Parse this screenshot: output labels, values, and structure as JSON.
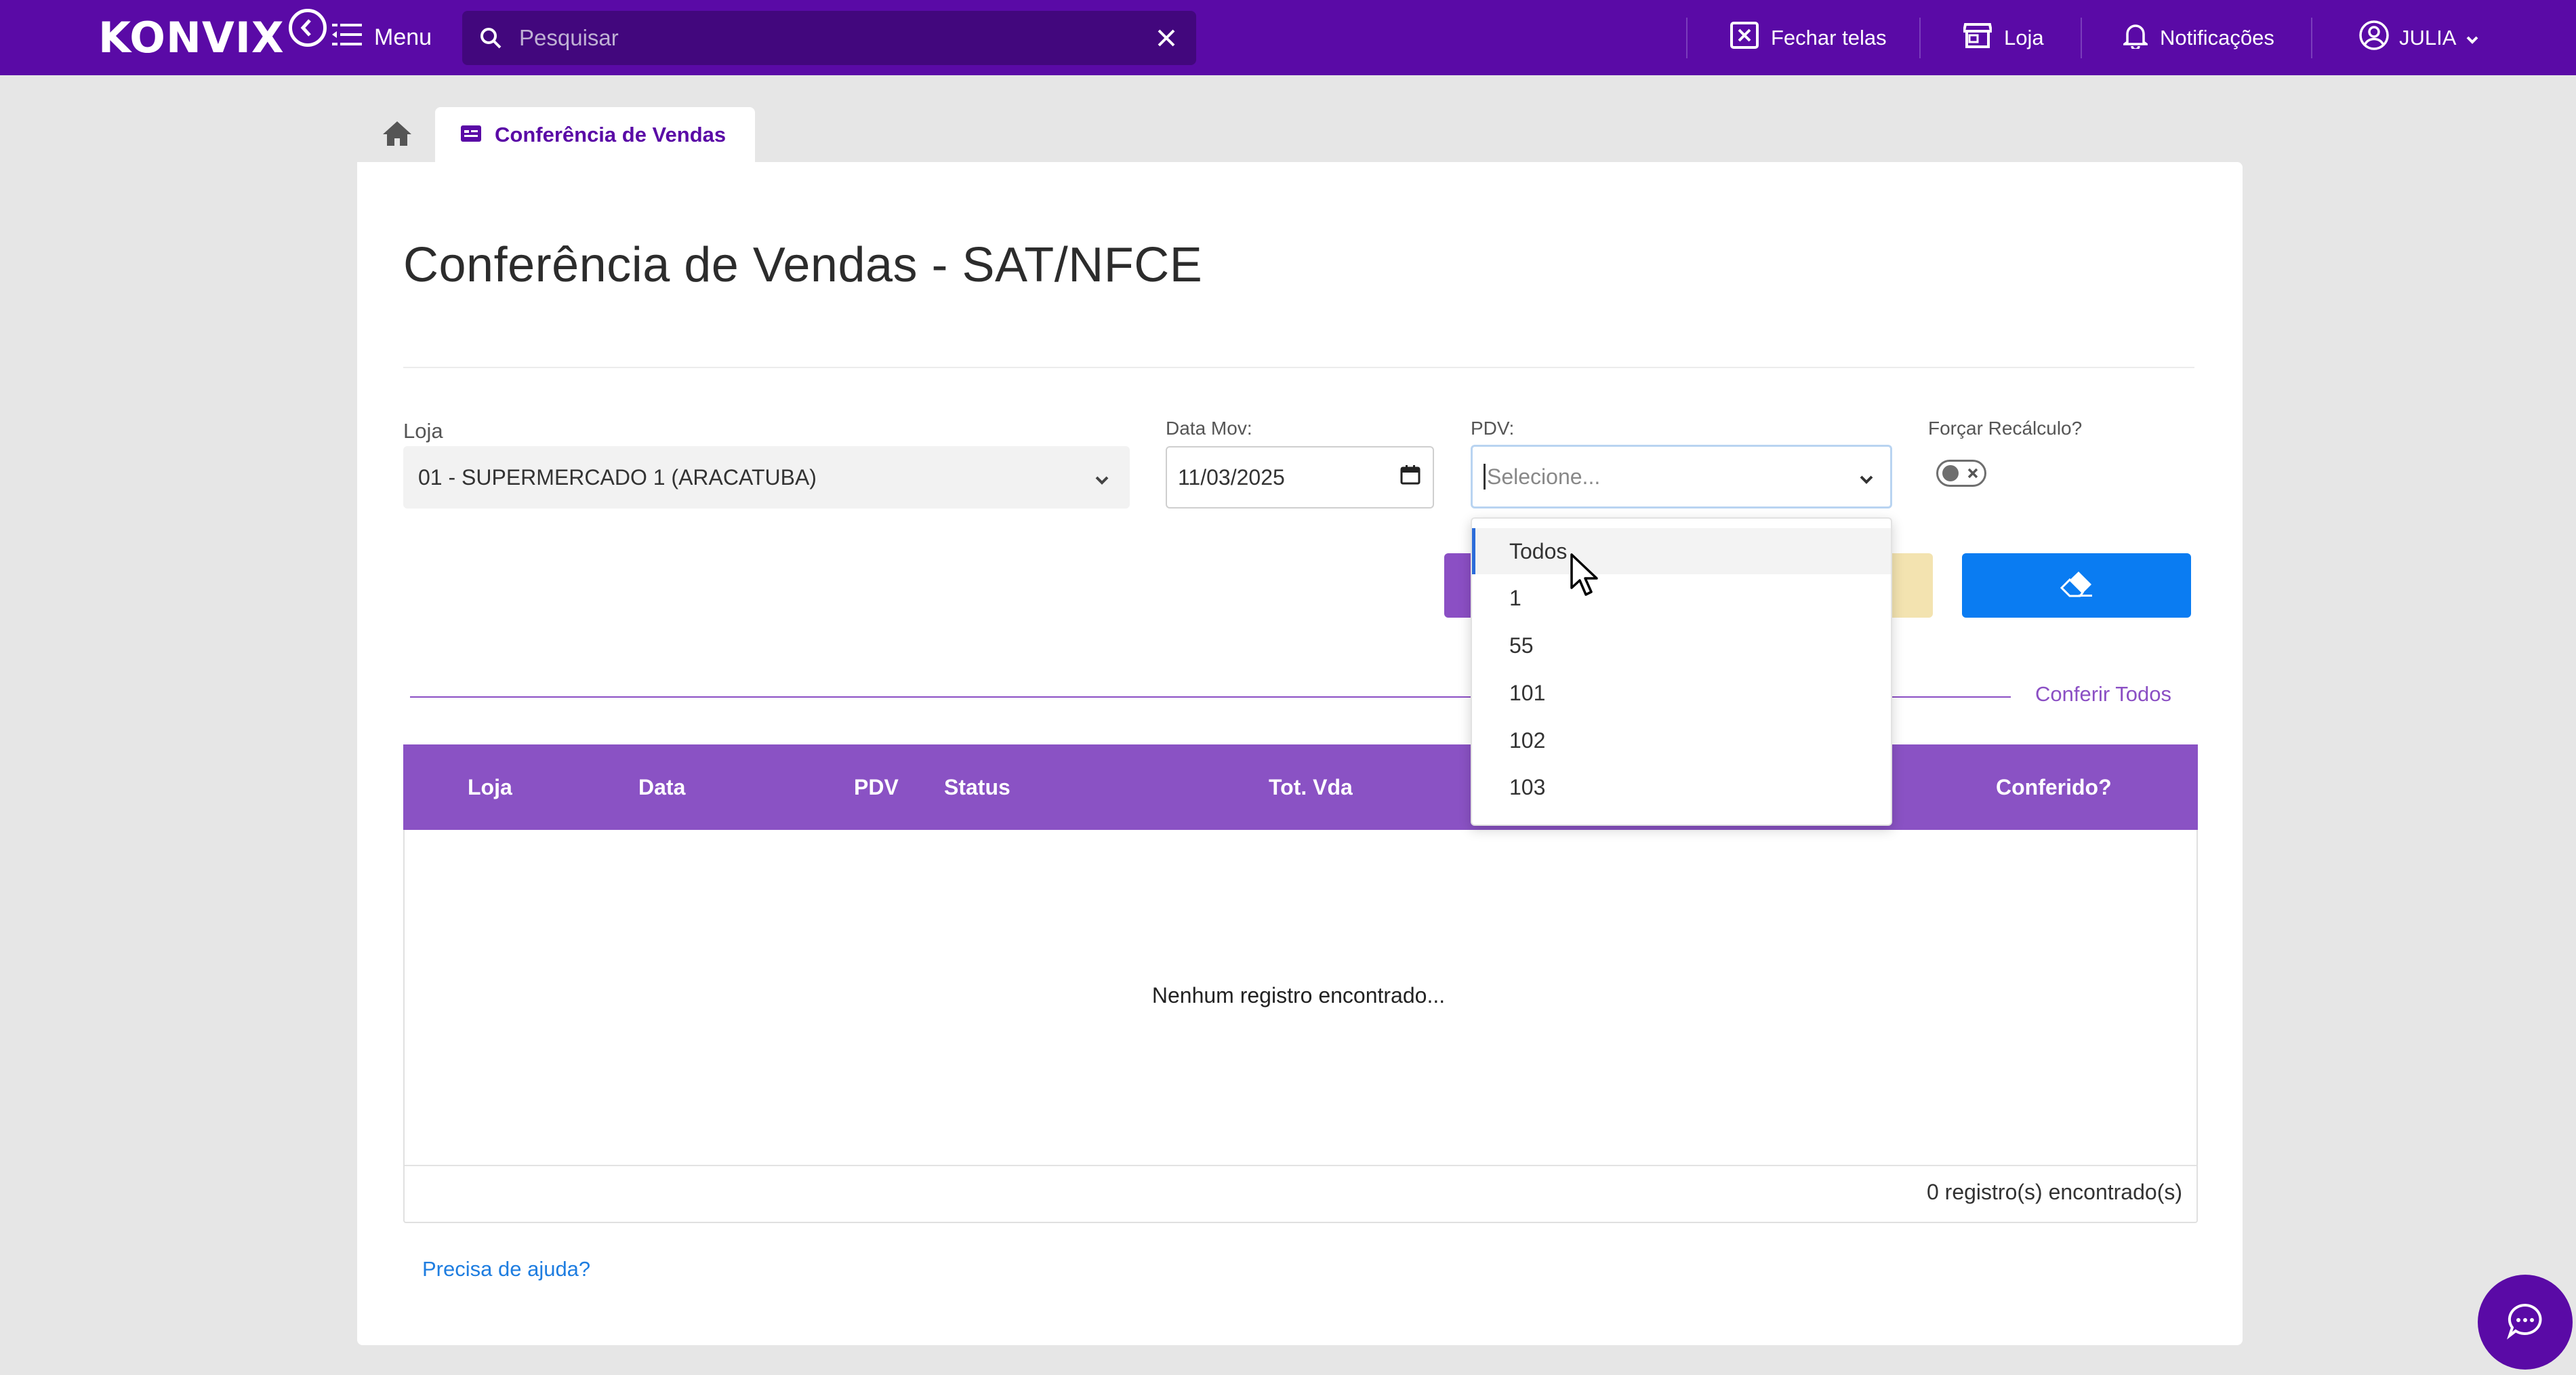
{
  "topbar": {
    "logo_text": "KONVIX",
    "menu_label": "Menu",
    "search_placeholder": "Pesquisar",
    "actions": {
      "fechar_telas": "Fechar telas",
      "loja": "Loja",
      "notificacoes": "Notificações",
      "user": "JULIA"
    }
  },
  "tabs": {
    "active_label": "Conferência de Vendas"
  },
  "page": {
    "title": "Conferência de Vendas - SAT/NFCE"
  },
  "filters": {
    "loja_label": "Loja",
    "loja_value": "01 - SUPERMERCADO 1 (ARACATUBA)",
    "data_label": "Data Mov:",
    "data_value": "11/03/2025",
    "pdv_label": "PDV:",
    "pdv_placeholder": "Selecione...",
    "forcar_label": "Forçar Recálculo?",
    "forcar_on": false
  },
  "pdv_dropdown": {
    "highlighted": "Todos",
    "options": [
      "Todos",
      "1",
      "55",
      "101",
      "102",
      "103"
    ]
  },
  "actions": {
    "conferir_todos": "Conferir Todos"
  },
  "table": {
    "columns": [
      "Loja",
      "Data",
      "PDV",
      "Status",
      "Tot. Vda",
      "Conferido?"
    ],
    "rows": [],
    "empty_message": "Nenhum registro encontrado...",
    "footer": "0 registro(s) encontrado(s)"
  },
  "help": {
    "label": "Precisa de ajuda?"
  },
  "colors": {
    "brand": "#5a0aa6",
    "table_header": "#8a52c4",
    "primary_button": "#0a7cf2"
  }
}
